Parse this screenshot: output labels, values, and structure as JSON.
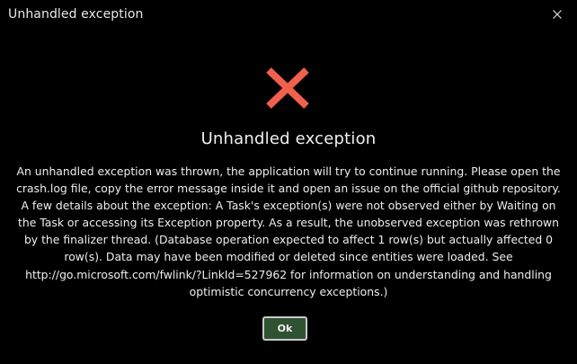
{
  "dialog": {
    "title": "Unhandled exception",
    "heading": "Unhandled exception",
    "message": "An unhandled exception was thrown, the application will try to continue running. Please open the crash.log file, copy the error message inside it and open an issue on the official github repository. A few details about the exception: A Task's exception(s) were not observed either by Waiting on the Task or accessing its Exception property. As a result, the unobserved exception was rethrown by the finalizer thread. (Database operation expected to affect 1 row(s) but actually affected 0 row(s). Data may have been modified or deleted since entities were loaded. See http://go.microsoft.com/fwlink/?LinkId=527962 for information on understanding and handling optimistic concurrency exceptions.)",
    "ok_label": "Ok",
    "close_icon": "close-icon",
    "error_icon": "error-x-icon"
  },
  "colors": {
    "background": "#000000",
    "error_icon": "#f0604d",
    "ok_button": "#2f5233",
    "ok_border": "#c9c9c9",
    "text": "#ededed"
  }
}
